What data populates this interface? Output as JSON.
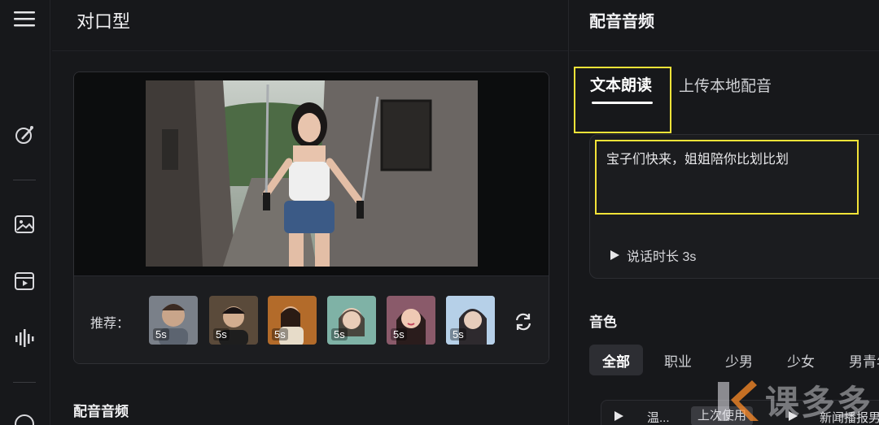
{
  "header": {
    "title": "对口型"
  },
  "preview": {
    "recommend_label": "推荐：",
    "thumbnails": [
      {
        "duration": "5s",
        "bg": "#7a8089",
        "skin": "#c9a58a"
      },
      {
        "duration": "5s",
        "bg": "#5a4a3a",
        "skin": "#d2ad8f"
      },
      {
        "duration": "5s",
        "bg": "#b36b2a",
        "skin": "#e2b896"
      },
      {
        "duration": "5s",
        "bg": "#7fb2a6",
        "skin": "#e9cdb8"
      },
      {
        "duration": "5s",
        "bg": "#8a5a6a",
        "skin": "#efc9b4"
      },
      {
        "duration": "5s",
        "bg": "#8fb2d6",
        "skin": "#e7cdbc"
      }
    ]
  },
  "section_audio": {
    "title": "配音音频"
  },
  "right_panel": {
    "title": "配音音频",
    "tabs": [
      {
        "label": "文本朗读",
        "active": true
      },
      {
        "label": "上传本地配音",
        "active": false
      }
    ],
    "text": "宝子们快来，姐姐陪你比划比划",
    "duration_label": "说话时长 3s",
    "voice_title": "音色",
    "filters": [
      "全部",
      "职业",
      "少男",
      "少女",
      "男青年"
    ],
    "voice_item": {
      "name": "温...",
      "badge": "上次使用",
      "name2": "新闻播报男"
    }
  },
  "watermark": "课多多",
  "colors": {
    "highlight": "#f3e338",
    "background": "#17181b"
  }
}
